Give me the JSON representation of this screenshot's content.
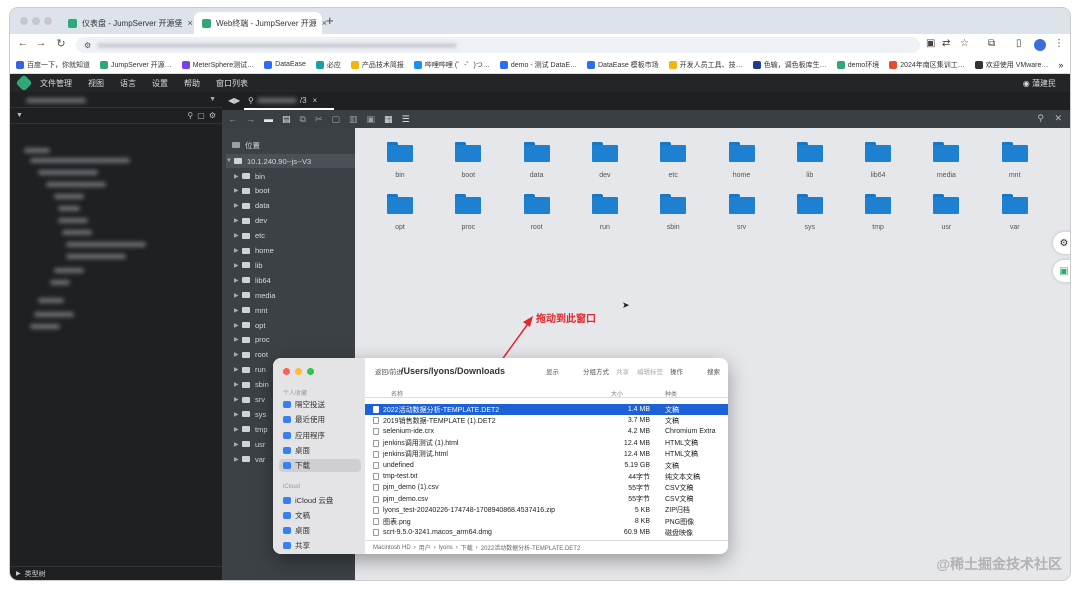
{
  "browser": {
    "tabs": [
      {
        "label": "仪表盘 - JumpServer 开源堡"
      },
      {
        "label": "Web终端 - JumpServer 开源"
      }
    ],
    "bookmarks": [
      {
        "label": "百度一下，你就知道",
        "color": "#3863e0"
      },
      {
        "label": "JumpServer 开源…",
        "color": "#2fa876"
      },
      {
        "label": "MeterSphere测试…",
        "color": "#7b3ef0"
      },
      {
        "label": "DataEase",
        "color": "#2d6df6"
      },
      {
        "label": "必应",
        "color": "#1aa0a0"
      },
      {
        "label": "产品技术简报",
        "color": "#f2b40f"
      },
      {
        "label": "哔哩哔哩 (゜-゜)つ…",
        "color": "#1d8ef2"
      },
      {
        "label": "demo - 测试 DataE…",
        "color": "#2d6df6"
      },
      {
        "label": "DataEase 模板市场",
        "color": "#2d6df6"
      },
      {
        "label": "开发人员工具、技…",
        "color": "#f2b40f"
      },
      {
        "label": "色输，调色板库生…",
        "color": "#1d3e86"
      },
      {
        "label": "demo环境",
        "color": "#2fa876"
      },
      {
        "label": "2024年南区集训工…",
        "color": "#e04e2e"
      },
      {
        "label": "欢迎使用 VMware…",
        "color": "#333333"
      }
    ]
  },
  "menu": {
    "items": [
      "文件管理",
      "视图",
      "语言",
      "设置",
      "帮助",
      "窗口列表"
    ],
    "user": "蒲建民"
  },
  "terminal_tab": {
    "suffix": "/3",
    "close": "×"
  },
  "sftp": {
    "position_label": "位置",
    "root": "10.1.240.90--js--V3",
    "tree": [
      "bin",
      "boot",
      "data",
      "dev",
      "etc",
      "home",
      "lib",
      "lib64",
      "media",
      "mnt",
      "opt",
      "proc",
      "root",
      "run",
      "sbin",
      "srv",
      "sys",
      "tmp",
      "usr",
      "var"
    ],
    "folders": [
      "bin",
      "boot",
      "data",
      "dev",
      "etc",
      "home",
      "lib",
      "lib64",
      "media",
      "mnt",
      "opt",
      "proc",
      "root",
      "run",
      "sbin",
      "srv",
      "sys",
      "tmp",
      "usr",
      "var"
    ]
  },
  "left_footer": "类型树",
  "annotation": "拖动到此窗口",
  "finder": {
    "back_forward": "返回/前进",
    "path": "/Users/lyons/Downloads",
    "toolbar": [
      "显示",
      "分组方式",
      "共享",
      "编辑标签",
      "操作",
      "搜索"
    ],
    "col_name": "名称",
    "col_size": "大小",
    "col_kind": "种类",
    "sidebar": {
      "section_personal": "个人收藏",
      "personal": [
        "隔空投送",
        "最近使用",
        "应用程序",
        "桌面",
        "下载"
      ],
      "section_cloud": "iCloud",
      "cloud": [
        "iCloud 云盘",
        "文稿",
        "桌面",
        "共享"
      ]
    },
    "files": [
      {
        "name": "2022活动数据分析-TEMPLATE.DET2",
        "size": "1.4 MB",
        "kind": "文稿"
      },
      {
        "name": "2019销售数据-TEMPLATE (1).DET2",
        "size": "3.7 MB",
        "kind": "文稿"
      },
      {
        "name": "selenium-ide.crx",
        "size": "4.2 MB",
        "kind": "Chromium Extra"
      },
      {
        "name": "jenkins调用测试 (1).html",
        "size": "12.4 MB",
        "kind": "HTML文稿"
      },
      {
        "name": "jenkins调用测试.html",
        "size": "12.4 MB",
        "kind": "HTML文稿"
      },
      {
        "name": "undefined",
        "size": "5.19 GB",
        "kind": "文稿"
      },
      {
        "name": "tmp-test.txt",
        "size": "44字节",
        "kind": "纯文本文稿"
      },
      {
        "name": "pjm_demo (1).csv",
        "size": "55字节",
        "kind": "CSV文稿"
      },
      {
        "name": "pjm_demo.csv",
        "size": "55字节",
        "kind": "CSV文稿"
      },
      {
        "name": "lyons_test-20240226-174748-1708940868.4537416.zip",
        "size": "5 KB",
        "kind": "ZIP归档"
      },
      {
        "name": "图表.png",
        "size": "8 KB",
        "kind": "PNG图像"
      },
      {
        "name": "scrt-9.5.0-3241.macos_arm64.dmg",
        "size": "60.9 MB",
        "kind": "磁盘映像"
      }
    ],
    "breadcrumb": [
      "Macintosh HD",
      "用户",
      "lyons",
      "下载",
      "2022活动数据分析-TEMPLATE.DET2"
    ]
  },
  "watermark": "@稀土掘金技术社区"
}
